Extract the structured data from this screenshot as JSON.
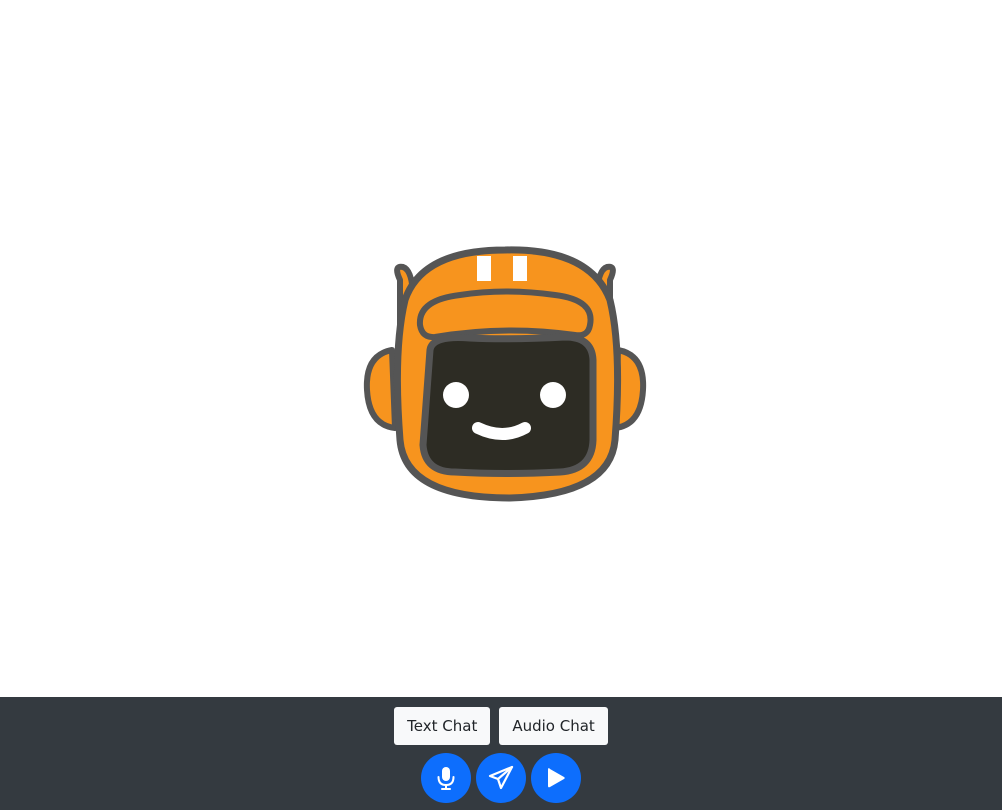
{
  "mascot": {
    "icon": "robot-mascot",
    "colors": {
      "helmet": "#f7941e",
      "outline": "#555555",
      "face": "#2d2c24",
      "features": "#ffffff"
    }
  },
  "footer": {
    "background": "#343a40",
    "mode_buttons": {
      "text_chat_label": "Text Chat",
      "audio_chat_label": "Audio Chat"
    },
    "action_buttons": {
      "color": "#0d6efd",
      "icons": [
        "microphone-icon",
        "send-icon",
        "play-icon"
      ]
    }
  }
}
